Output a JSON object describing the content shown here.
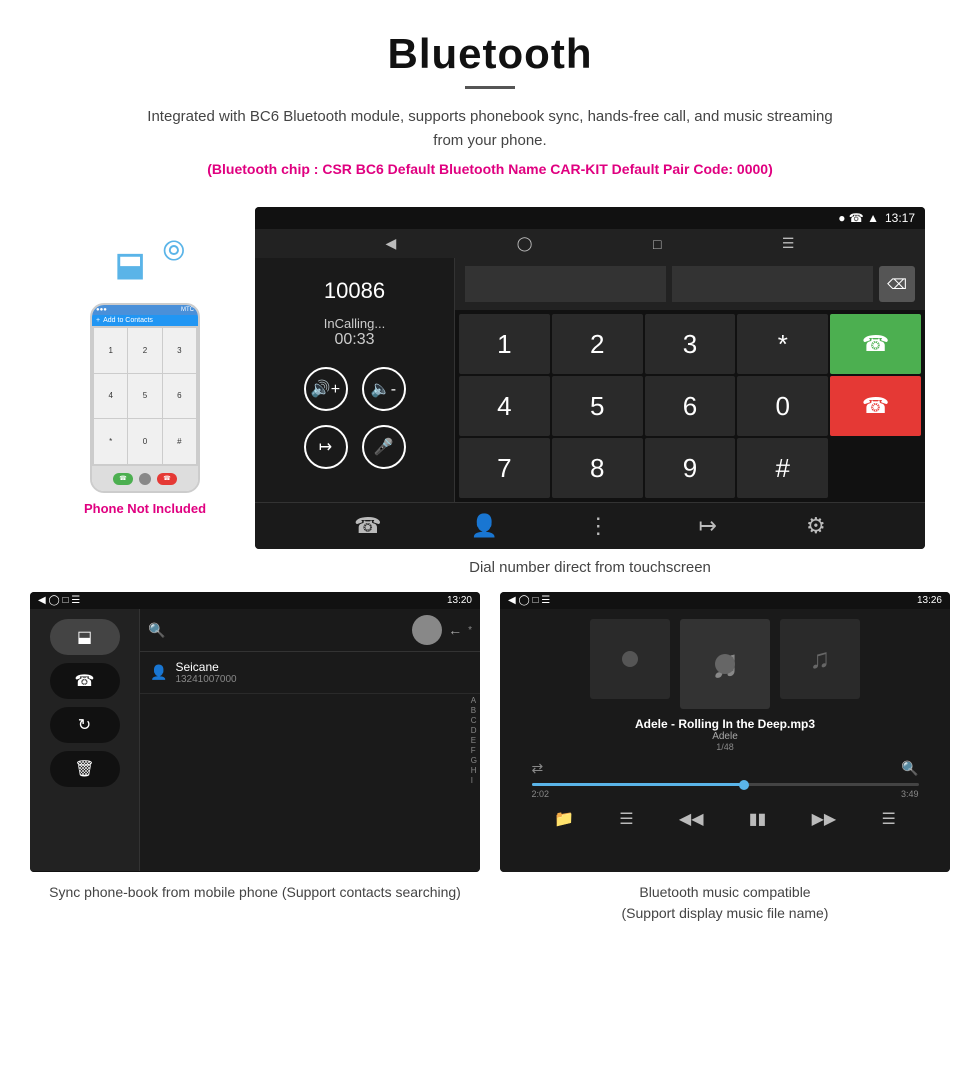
{
  "header": {
    "title": "Bluetooth",
    "subtitle": "Integrated with BC6 Bluetooth module, supports phonebook sync, hands-free call, and music streaming from your phone.",
    "chip_info": "(Bluetooth chip : CSR BC6    Default Bluetooth Name CAR-KIT    Default Pair Code: 0000)"
  },
  "phone_label": "Phone Not Included",
  "dial_screen": {
    "time": "13:17",
    "number": "10086",
    "status": "InCalling...",
    "timer": "00:33",
    "keys": [
      "1",
      "2",
      "3",
      "*",
      "4",
      "5",
      "6",
      "0",
      "7",
      "8",
      "9",
      "#"
    ]
  },
  "dial_caption": "Dial number direct from touchscreen",
  "phonebook_screen": {
    "time": "13:20",
    "contact_name": "Seicane",
    "contact_number": "13241007000",
    "alphabet": [
      "A",
      "B",
      "C",
      "D",
      "E",
      "F",
      "G",
      "H",
      "I"
    ]
  },
  "phonebook_caption": "Sync phone-book from mobile phone\n(Support contacts searching)",
  "music_screen": {
    "time": "13:26",
    "song": "Adele - Rolling In the Deep.mp3",
    "artist": "Adele",
    "track": "1/48",
    "time_current": "2:02",
    "time_total": "3:49"
  },
  "music_caption": "Bluetooth music compatible\n(Support display music file name)"
}
